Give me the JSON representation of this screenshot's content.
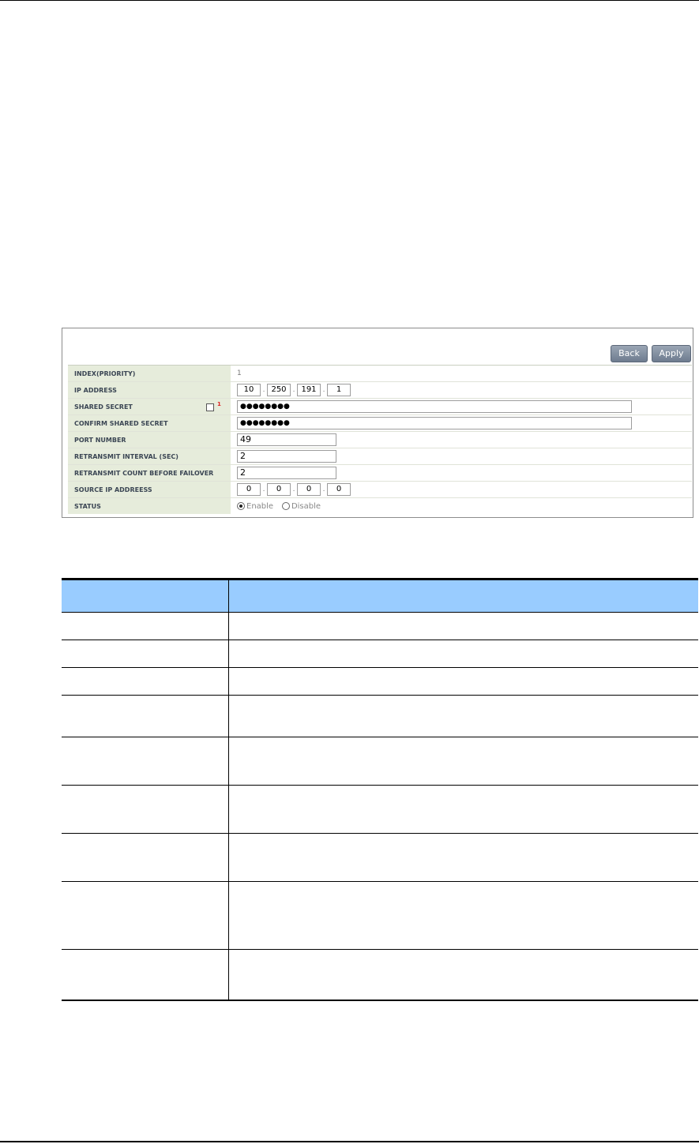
{
  "toolbar": {
    "back_label": "Back",
    "apply_label": "Apply"
  },
  "form": {
    "index": {
      "label": "INDEX(PRIORITY)",
      "value": "1"
    },
    "ip_address": {
      "label": "IP ADDRESS",
      "octets": [
        "10",
        "250",
        "191",
        "1"
      ]
    },
    "shared_secret": {
      "label": "SHARED SECRET",
      "marker": "1",
      "value": "●●●●●●●●"
    },
    "confirm_shared_secret": {
      "label": "CONFIRM SHARED SECRET",
      "value": "●●●●●●●●"
    },
    "port_number": {
      "label": "PORT NUMBER",
      "value": "49"
    },
    "retransmit_interval": {
      "label": "RETRANSMIT INTERVAL (SEC)",
      "value": "2"
    },
    "retransmit_count": {
      "label": "RETRANSMIT COUNT BEFORE FAILOVER",
      "value": "2"
    },
    "source_ip": {
      "label": "SOURCE IP ADDREESS",
      "octets": [
        "0",
        "0",
        "0",
        "0"
      ]
    },
    "status": {
      "label": "STATUS",
      "enable_label": "Enable",
      "disable_label": "Disable",
      "selected": "Enable"
    }
  }
}
